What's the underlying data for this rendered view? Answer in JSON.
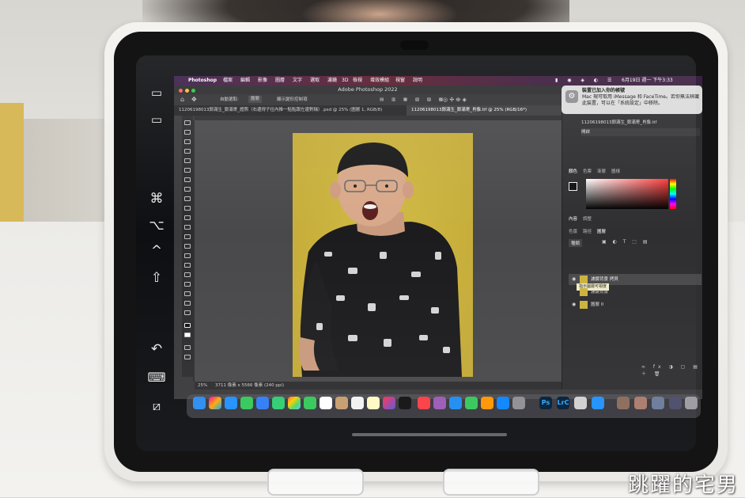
{
  "menubar": {
    "apple": "",
    "app_name": "Photoshop",
    "menus": [
      "檔案",
      "編輯",
      "影像",
      "圖層",
      "文字",
      "選取",
      "濾鏡",
      "3D",
      "檢視",
      "增效模組",
      "視窗",
      "說明"
    ],
    "clock": "6月19日 週一 下午3:33"
  },
  "window": {
    "title": "Adobe Photoshop 2022",
    "tabs": [
      {
        "label": "11206198013鄭滿生_鄭滿寄_證照（右邊得子往內推一點點跟左邊對稱）.psd @ 25% (圖層 1, RGB/8)",
        "active": false
      },
      {
        "label": "11206198013鄭滿生_鄭滿寄_肖像.tif @ 25% (RGB/16*)",
        "active": true
      }
    ]
  },
  "options_bar": {
    "auto_select_label": "自動選取:",
    "auto_select_value": "圖層",
    "show_transform": "顯示變形控制項"
  },
  "status_bar": {
    "zoom": "25%",
    "doc_info": "3711 像素 x 5566 像素 (240 ppi)"
  },
  "notification": {
    "title": "裝置已加入你的帳號",
    "body": "Mac 現可取用 iMessage 和 FaceTime。若你無法辨識此裝置，可以在「系統設定」中移除。"
  },
  "panels": {
    "color_tabs": [
      "顏色",
      "色票",
      "漸層",
      "圖樣"
    ],
    "props_tabs": [
      "內容",
      "調整"
    ],
    "layer_tabs": [
      "色版",
      "路徑",
      "圖層"
    ],
    "kind_label": "種類",
    "layers": [
      {
        "name": "濾鏡背景 拷貝",
        "tooltip": "指示圖層可視度"
      },
      {
        "name": "濾鏡背景"
      },
      {
        "name": "圖層 0"
      }
    ],
    "doc_filename": "11206198013鄭滿生_鄭滿寄_肖像.tif",
    "history_label": "開啟"
  },
  "sidecar": {
    "icons": [
      "menu-bar-icon",
      "dock-icon",
      "command-icon",
      "option-icon",
      "control-icon",
      "shift-icon",
      "undo-icon",
      "keyboard-icon",
      "disconnect-icon"
    ],
    "glyphs": [
      "▭",
      "▭",
      "⌘",
      "⌥",
      "^",
      "⇧",
      "↶",
      "⌨",
      "⧄"
    ]
  },
  "watermark": "跳躍的宅男",
  "colors": {
    "photo_background": "#cbb33f",
    "menubar": "#4a1d34",
    "case": "#efeeea"
  }
}
